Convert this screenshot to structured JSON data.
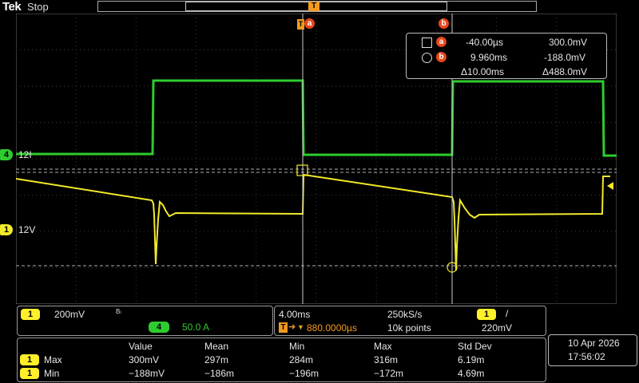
{
  "header": {
    "brand": "Tek",
    "run_state": "Stop"
  },
  "channels": {
    "ch4": {
      "number": "4",
      "label": "12I",
      "color": "#2ecc2e"
    },
    "ch1": {
      "number": "1",
      "label": "12V",
      "color": "#f2ea2a"
    }
  },
  "cursors": {
    "a_label": "a",
    "b_label": "b",
    "readout": {
      "a_time": "-40.00µs",
      "a_value": "300.0mV",
      "b_time": "9.960ms",
      "b_value": "-188.0mV",
      "delta_time": "Δ10.00ms",
      "delta_value": "Δ488.0mV"
    }
  },
  "trigger_marker": "T",
  "vertical": {
    "ch1_badge": "1",
    "ch1_scale": "200mV",
    "bw_marker": "Bₗ",
    "ch4_badge": "4",
    "ch4_scale": "50.0 A"
  },
  "horizontal": {
    "time_div": "4.00ms",
    "sample_rate": "250kS/s",
    "trigger_source_badge": "1",
    "trigger_slope": "/",
    "trigger_position": "880.0000µs",
    "record_length": "10k points",
    "trigger_level": "220mV"
  },
  "measurements": {
    "headers": [
      "Value",
      "Mean",
      "Min",
      "Max",
      "Std Dev"
    ],
    "rows": [
      {
        "badge": "1",
        "name": "Max",
        "value": "300mV",
        "mean": "297m",
        "min": "284m",
        "max": "316m",
        "std": "6.19m"
      },
      {
        "badge": "1",
        "name": "Min",
        "value": "−188mV",
        "mean": "−186m",
        "min": "−196m",
        "max": "−172m",
        "std": "4.69m"
      }
    ]
  },
  "datetime": {
    "date": "10 Apr  2026",
    "time": "17:56:02"
  }
}
